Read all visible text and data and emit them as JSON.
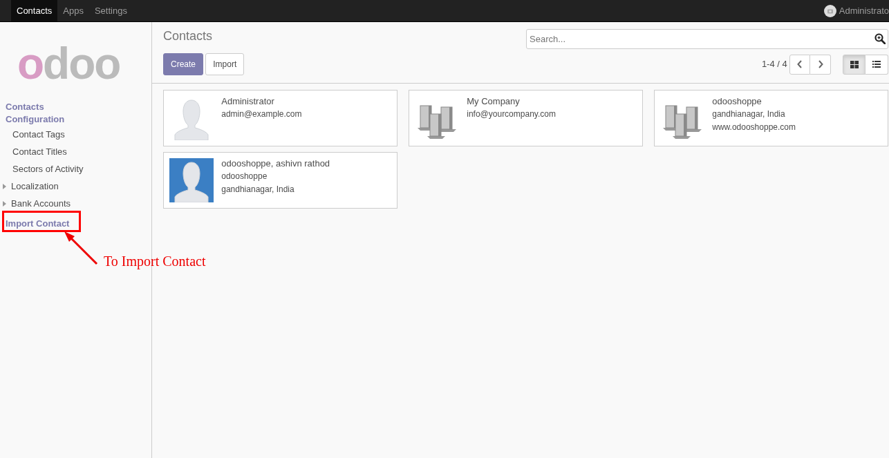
{
  "topbar": {
    "apps": [
      {
        "label": "Contacts",
        "selected": true
      },
      {
        "label": "Apps",
        "selected": false
      },
      {
        "label": "Settings",
        "selected": false
      }
    ],
    "user": "Administrato"
  },
  "logo": {
    "text": "odoo"
  },
  "sidebar": [
    {
      "kind": "section",
      "label": "Contacts"
    },
    {
      "kind": "section",
      "label": "Configuration"
    },
    {
      "kind": "item",
      "label": "Contact Tags"
    },
    {
      "kind": "item",
      "label": "Contact Titles"
    },
    {
      "kind": "item",
      "label": "Sectors of Activity"
    },
    {
      "kind": "folder",
      "label": "Localization",
      "expanded": false
    },
    {
      "kind": "folder",
      "label": "Bank Accounts",
      "expanded": false
    },
    {
      "kind": "section",
      "label": "Import Contact",
      "highlighted": true
    }
  ],
  "annotation": {
    "text": "To Import Contact"
  },
  "title": "Contacts",
  "buttons": [
    {
      "label": "Create",
      "kind": "primary"
    },
    {
      "label": "Import",
      "kind": "secondary"
    }
  ],
  "search": {
    "placeholder": "Search..."
  },
  "pager": "1-4 / 4",
  "views": [
    {
      "kind": "kanban",
      "selected": true
    },
    {
      "kind": "list",
      "selected": false
    }
  ],
  "cards": [
    {
      "kind": "person",
      "name": "Administrator",
      "lines": [
        "admin@example.com"
      ]
    },
    {
      "kind": "company",
      "name": "My Company",
      "lines": [
        "info@yourcompany.com"
      ]
    },
    {
      "kind": "company",
      "name": "odooshoppe",
      "lines": [
        "gandhianagar, India",
        "www.odooshoppe.com"
      ]
    },
    {
      "kind": "person_photo",
      "name": "odooshoppe, ashivn rathod",
      "lines": [
        "odooshoppe",
        "gandhianagar, India"
      ]
    }
  ]
}
